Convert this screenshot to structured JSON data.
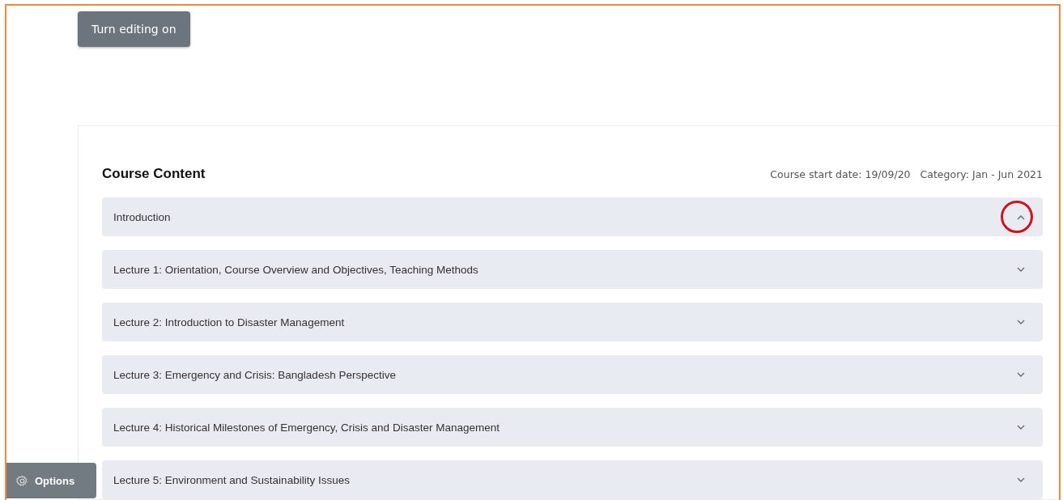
{
  "edit_button": {
    "label": "Turn editing on"
  },
  "course": {
    "title": "Course Content",
    "start_date": "Course start date: 19/09/20",
    "category": "Category: Jan - Jun 2021"
  },
  "sections": [
    {
      "title": "Introduction",
      "expanded": true,
      "annotated": true
    },
    {
      "title": "Lecture 1: Orientation, Course Overview and Objectives, Teaching Methods",
      "expanded": false,
      "annotated": false
    },
    {
      "title": "Lecture 2: Introduction to Disaster Management",
      "expanded": false,
      "annotated": false
    },
    {
      "title": "Lecture 3: Emergency and Crisis: Bangladesh Perspective",
      "expanded": false,
      "annotated": false
    },
    {
      "title": "Lecture 4: Historical Milestones of Emergency, Crisis and Disaster Management",
      "expanded": false,
      "annotated": false
    },
    {
      "title": "Lecture 5: Environment and Sustainability Issues",
      "expanded": false,
      "annotated": false
    }
  ],
  "options_button": {
    "label": "Options"
  }
}
